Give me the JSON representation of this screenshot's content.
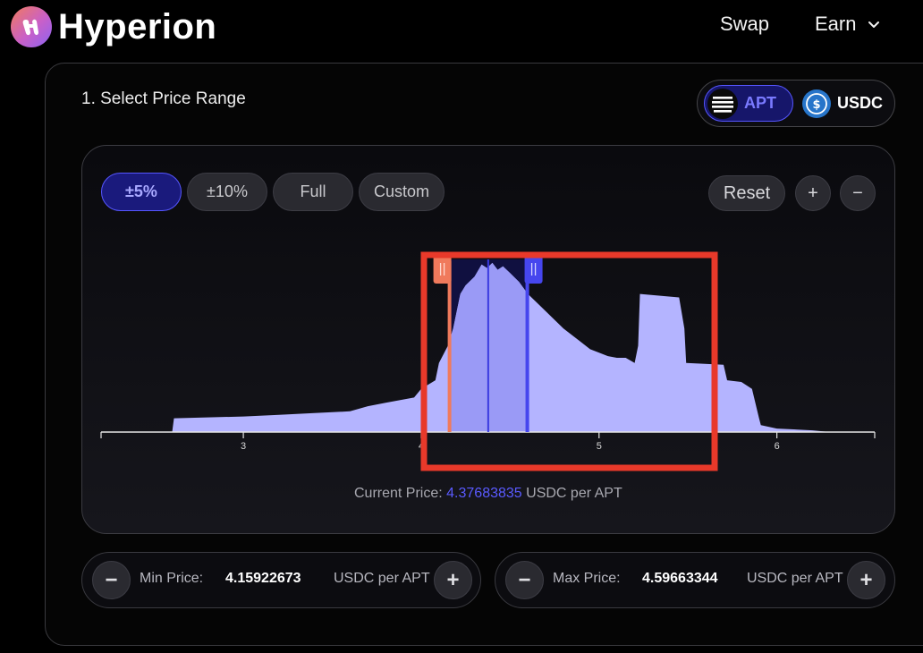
{
  "header": {
    "brand": "Hyperion",
    "nav": {
      "swap": "Swap",
      "earn": "Earn"
    }
  },
  "section_title": "1. Select Price Range",
  "token_toggle": {
    "apt": "APT",
    "usdc": "USDC",
    "selected": "APT"
  },
  "range_presets": [
    "±5%",
    "±10%",
    "Full",
    "Custom"
  ],
  "active_preset": "±5%",
  "chart_controls": {
    "reset": "Reset",
    "zoom_in": "+",
    "zoom_out": "−"
  },
  "current_price": {
    "label": "Current Price:",
    "value": "4.37683835",
    "unit": "USDC per APT"
  },
  "min_price": {
    "label": "Min Price:",
    "value": "4.15922673",
    "unit": "USDC per APT",
    "minus": "−",
    "plus": "+"
  },
  "max_price": {
    "label": "Max Price:",
    "value": "4.59663344",
    "unit": "USDC per APT",
    "minus": "−",
    "plus": "+"
  },
  "colors": {
    "accent": "#4a4aff",
    "histogram": "#b4b4ff",
    "selected_range": "#9a9af6",
    "min_handle": "#f07a5c",
    "max_handle": "#4646ee",
    "highlight_box": "#e8392a"
  },
  "chart_data": {
    "type": "area",
    "xlabel": "",
    "ylabel": "",
    "x_ticks": [
      3,
      4,
      5,
      6
    ],
    "xlim": [
      2.2,
      6.55
    ],
    "ylim": [
      0,
      1
    ],
    "current_price": 4.37683835,
    "selected_range": [
      4.15922673,
      4.59663344
    ],
    "x": [
      2.2,
      2.6,
      2.61,
      3.0,
      3.2,
      3.4,
      3.6,
      3.7,
      3.8,
      3.96,
      4.0,
      4.08,
      4.1,
      4.15,
      4.18,
      4.22,
      4.25,
      4.3,
      4.34,
      4.37,
      4.4,
      4.43,
      4.46,
      4.5,
      4.55,
      4.6,
      4.65,
      4.7,
      4.8,
      4.9,
      4.95,
      5.0,
      5.05,
      5.1,
      5.15,
      5.2,
      5.22,
      5.23,
      5.45,
      5.48,
      5.49,
      5.7,
      5.72,
      5.8,
      5.86,
      5.9,
      5.91,
      6.0,
      6.2,
      6.3,
      6.55
    ],
    "y": [
      0.0,
      0.0,
      0.08,
      0.09,
      0.1,
      0.11,
      0.12,
      0.15,
      0.17,
      0.2,
      0.25,
      0.3,
      0.4,
      0.5,
      0.6,
      0.8,
      0.85,
      0.9,
      0.97,
      0.95,
      0.98,
      0.94,
      0.96,
      0.92,
      0.87,
      0.8,
      0.75,
      0.7,
      0.6,
      0.52,
      0.48,
      0.46,
      0.44,
      0.43,
      0.43,
      0.4,
      0.5,
      0.8,
      0.78,
      0.6,
      0.4,
      0.39,
      0.3,
      0.29,
      0.25,
      0.08,
      0.04,
      0.02,
      0.01,
      0.0,
      0.0
    ]
  }
}
